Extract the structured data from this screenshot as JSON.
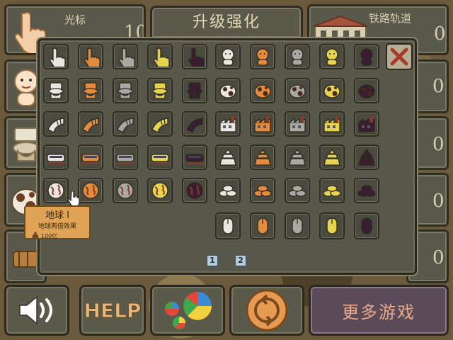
{
  "title": "升级强化",
  "left_cards": [
    {
      "label": "光标",
      "count": "10"
    },
    {
      "label": "",
      "count": ""
    },
    {
      "label": "",
      "count": ""
    },
    {
      "label": "",
      "count": ""
    },
    {
      "label": "",
      "count": ""
    }
  ],
  "right_cards": [
    {
      "label": "铁路轨道",
      "count": "0"
    },
    {
      "label": "",
      "count": "0"
    },
    {
      "label": "",
      "count": "0"
    },
    {
      "label": "",
      "count": "0"
    },
    {
      "label": "",
      "count": "0"
    }
  ],
  "grid_rows": [
    {
      "row": "cursor",
      "icons": [
        "cursor-white-icon",
        "cursor-orange-icon",
        "cursor-grey-icon",
        "cursor-yellow-icon",
        "cursor-dark-icon",
        "baby-white-icon",
        "baby-orange-icon",
        "baby-grey-icon",
        "baby-yellow-icon",
        "baby-dark-icon"
      ]
    },
    {
      "row": "toilet",
      "icons": [
        "toilet-white-icon",
        "toilet-orange-icon",
        "toilet-grey-icon",
        "toilet-yellow-icon",
        "toilet-dark-icon",
        "cow-white-icon",
        "cow-orange-icon",
        "cow-grey-icon",
        "cow-yellow-icon",
        "cow-dark-icon"
      ]
    },
    {
      "row": "pipe",
      "icons": [
        "pipe-white-icon",
        "pipe-orange-icon",
        "pipe-grey-icon",
        "pipe-yellow-icon",
        "pipe-dark-icon",
        "factory-white-icon",
        "factory-orange-icon",
        "factory-grey-icon",
        "factory-yellow-icon",
        "factory-dark-icon"
      ]
    },
    {
      "row": "train",
      "icons": [
        "train-white-icon",
        "train-orange-icon",
        "train-grey-icon",
        "train-yellow-icon",
        "train-dark-icon",
        "temple-white-icon",
        "temple-orange-icon",
        "temple-grey-icon",
        "temple-yellow-icon",
        "temple-dark-icon"
      ]
    },
    {
      "row": "globe",
      "icons": [
        "globe-white-icon",
        "globe-orange-icon",
        "globe-grey-icon",
        "globe-yellow-icon",
        "globe-dark-icon",
        "coins-white-icon",
        "coins-orange-icon",
        "coins-grey-icon",
        "coins-yellow-icon",
        "coins-dark-icon"
      ]
    },
    {
      "row": "mouse",
      "icons": [
        "mouse-white-icon",
        "mouse-orange-icon",
        "mouse-grey-icon",
        "mouse-yellow-icon",
        "mouse-dark-icon"
      ]
    }
  ],
  "tooltip": {
    "name": "地球 I",
    "desc": "地球两倍效果",
    "cost": "100亿"
  },
  "pages": [
    "1",
    "2"
  ],
  "buttons": {
    "sound": "sound-icon",
    "help": "HELP",
    "stats": "stats-pie-icon",
    "reset": "reset-icon",
    "more_games": "更多游戏"
  },
  "colors": {
    "white": "#e8e6df",
    "orange": "#e38a3c",
    "grey": "#a9a9a4",
    "yellow": "#e6d34e",
    "dark": "#3a1d30"
  }
}
